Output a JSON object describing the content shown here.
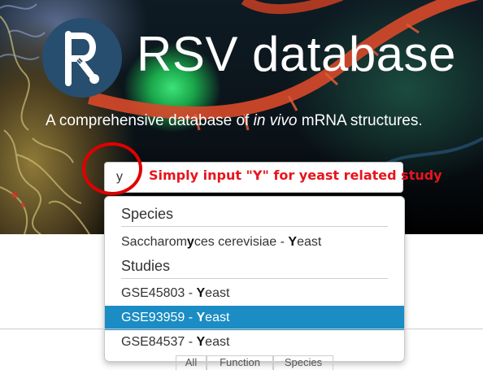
{
  "header": {
    "title": "RSV database",
    "subtitle_before": "A comprehensive database of ",
    "subtitle_italic": "in vivo",
    "subtitle_after": " mRNA structures."
  },
  "logo": {
    "icon": "rsv-logo-icon",
    "color": "#274e6f"
  },
  "search": {
    "value": "y"
  },
  "annotation": {
    "text": "Simply input \"Y\" for yeast related study",
    "color": "#e8141c"
  },
  "dropdown": {
    "species_header": "Species",
    "studies_header": "Studies",
    "species_items": [
      {
        "name_pre": "Saccharom",
        "name_match": "y",
        "name_post": "ces cerevisiae",
        "sep": " - ",
        "tag_match": "Y",
        "tag_post": "east"
      }
    ],
    "study_items": [
      {
        "id": "GSE45803",
        "sep": " - ",
        "tag_match": "Y",
        "tag_post": "east"
      },
      {
        "id": "GSE93959",
        "sep": " - ",
        "tag_match": "Y",
        "tag_post": "east"
      },
      {
        "id": "GSE84537",
        "sep": " - ",
        "tag_match": "Y",
        "tag_post": "east"
      }
    ],
    "selected_color": "#1b8cc4"
  },
  "tabs": [
    "All",
    "Function",
    "Species"
  ]
}
